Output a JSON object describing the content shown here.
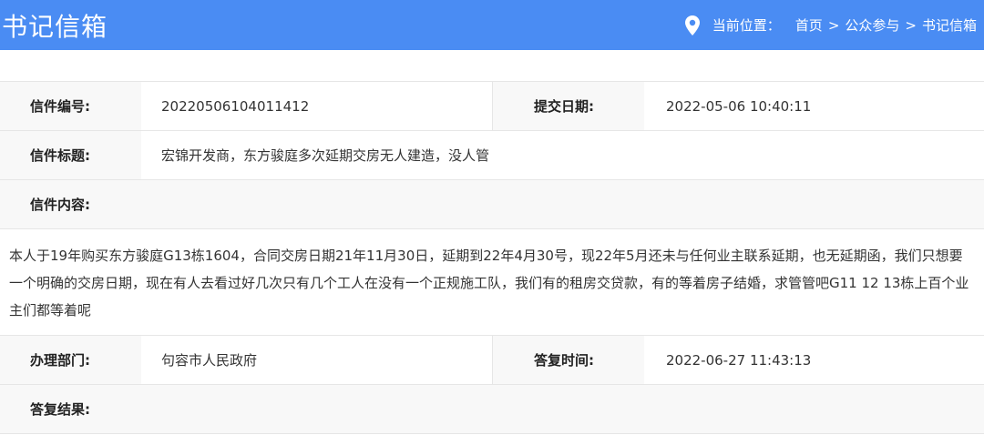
{
  "header": {
    "title": "书记信箱",
    "location_label": "当前位置：",
    "breadcrumb": [
      "首页",
      ">",
      "公众参与",
      ">",
      "书记信箱"
    ]
  },
  "letter": {
    "number_label": "信件编号:",
    "number": "20220506104011412",
    "submit_date_label": "提交日期:",
    "submit_date": "2022-05-06 10:40:11",
    "subject_label": "信件标题:",
    "subject": "宏锦开发商，东方骏庭多次延期交房无人建造，没人管",
    "content_label": "信件内容:",
    "content": "本人于19年购买东方骏庭G13栋1604，合同交房日期21年11月30日，延期到22年4月30号，现22年5月还未与任何业主联系延期，也无延期函，我们只想要一个明确的交房日期，现在有人去看过好几次只有几个工人在没有一个正规施工队，我们有的租房交贷款，有的等着房子结婚，求管管吧G11 12 13栋上百个业主们都等着呢",
    "department_label": "办理部门:",
    "department": "句容市人民政府",
    "reply_time_label": "答复时间:",
    "reply_time": "2022-06-27 11:43:13",
    "reply_result_label": "答复结果:"
  }
}
